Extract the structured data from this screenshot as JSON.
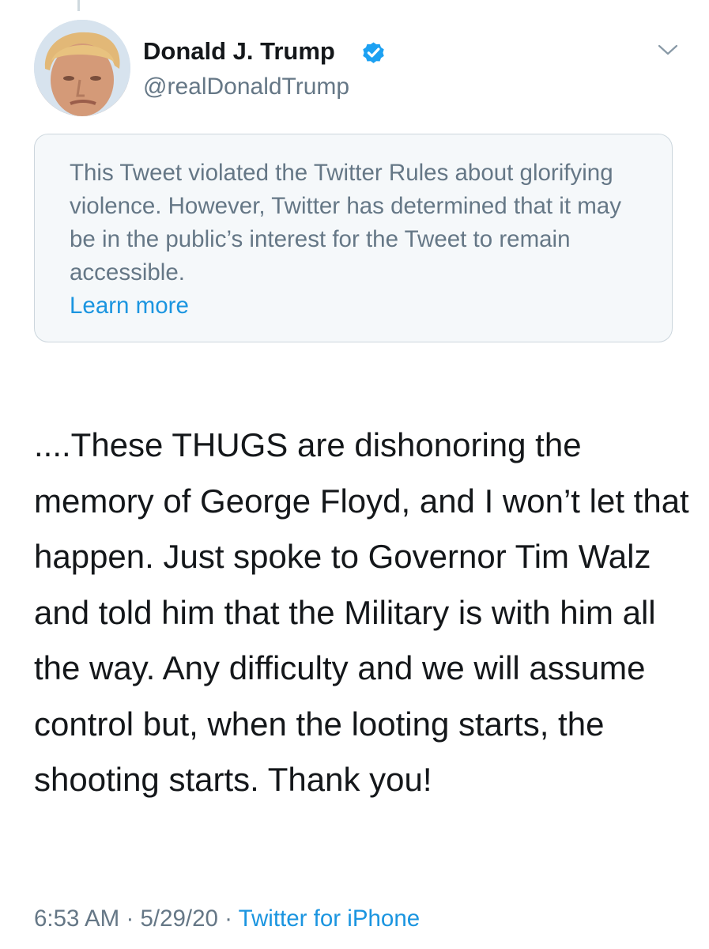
{
  "tweet": {
    "author": {
      "display_name": "Donald J. Trump",
      "handle": "@realDonaldTrump",
      "verified": true,
      "avatar_icon": "profile-photo"
    },
    "notice": {
      "text": "This Tweet violated the Twitter Rules about glorifying violence. However, Twitter has determined that it may be in the public’s interest for the Tweet to remain accessible.",
      "link_label": "Learn more"
    },
    "body": "....These THUGS are dishonoring the memory of George Floyd, and I won’t let that happen. Just spoke to Governor Tim Walz and told him that the Military is with him all the way. Any difficulty and we will assume control but, when the looting starts, the shooting starts. Thank you!",
    "time": "6:53 AM",
    "date": "5/29/20",
    "separator": "·",
    "source": "Twitter for iPhone"
  },
  "colors": {
    "text_primary": "#14171a",
    "text_secondary": "#657786",
    "link": "#1b95e0",
    "verified_badge": "#1da1f2",
    "notice_bg": "#f5f8fa",
    "notice_border": "#ccd6dd"
  }
}
